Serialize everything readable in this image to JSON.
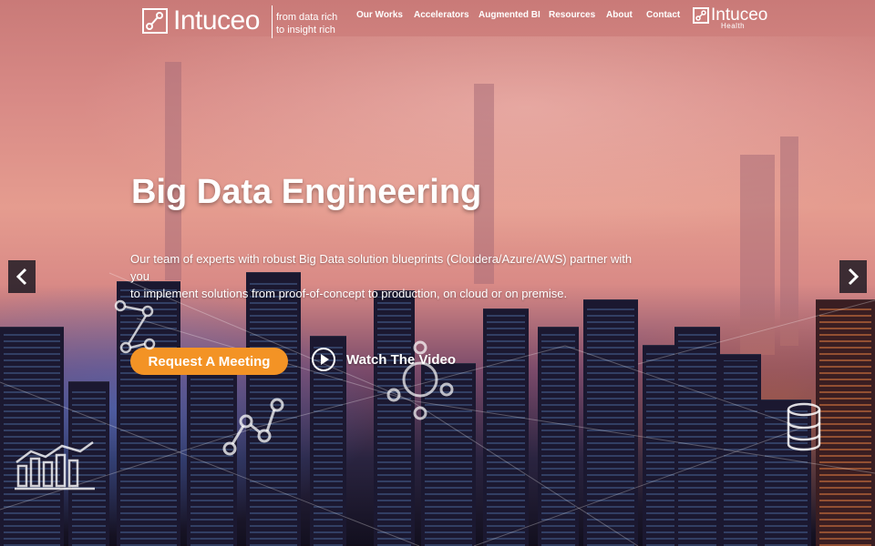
{
  "brand": {
    "name": "Intuceo",
    "tagline_line1": "from data rich",
    "tagline_line2": "to insight rich"
  },
  "nav": {
    "items": [
      {
        "label": "Our Works",
        "name": "nav-our-works"
      },
      {
        "label": "Accelerators",
        "name": "nav-accelerators"
      },
      {
        "label": "Augmented BI",
        "name": "nav-augmented-bi"
      },
      {
        "label": "Resources",
        "name": "nav-resources"
      },
      {
        "label": "About",
        "name": "nav-about"
      },
      {
        "label": "Contact",
        "name": "nav-contact"
      }
    ]
  },
  "health_logo": {
    "name": "Intuceo",
    "sub": "Health"
  },
  "hero": {
    "title": "Big Data Engineering",
    "desc_line1": "Our team of experts with robust Big Data solution blueprints (Cloudera/Azure/AWS) partner with you",
    "desc_line2": "to implement solutions from proof-of-concept to production, on cloud or on premise.",
    "cta": "Request A Meeting",
    "video": "Watch The Video"
  },
  "carousel": {
    "prev_icon": "chevron-left-icon",
    "next_icon": "chevron-right-icon"
  },
  "colors": {
    "accent": "#f39325",
    "text": "#ffffff"
  }
}
